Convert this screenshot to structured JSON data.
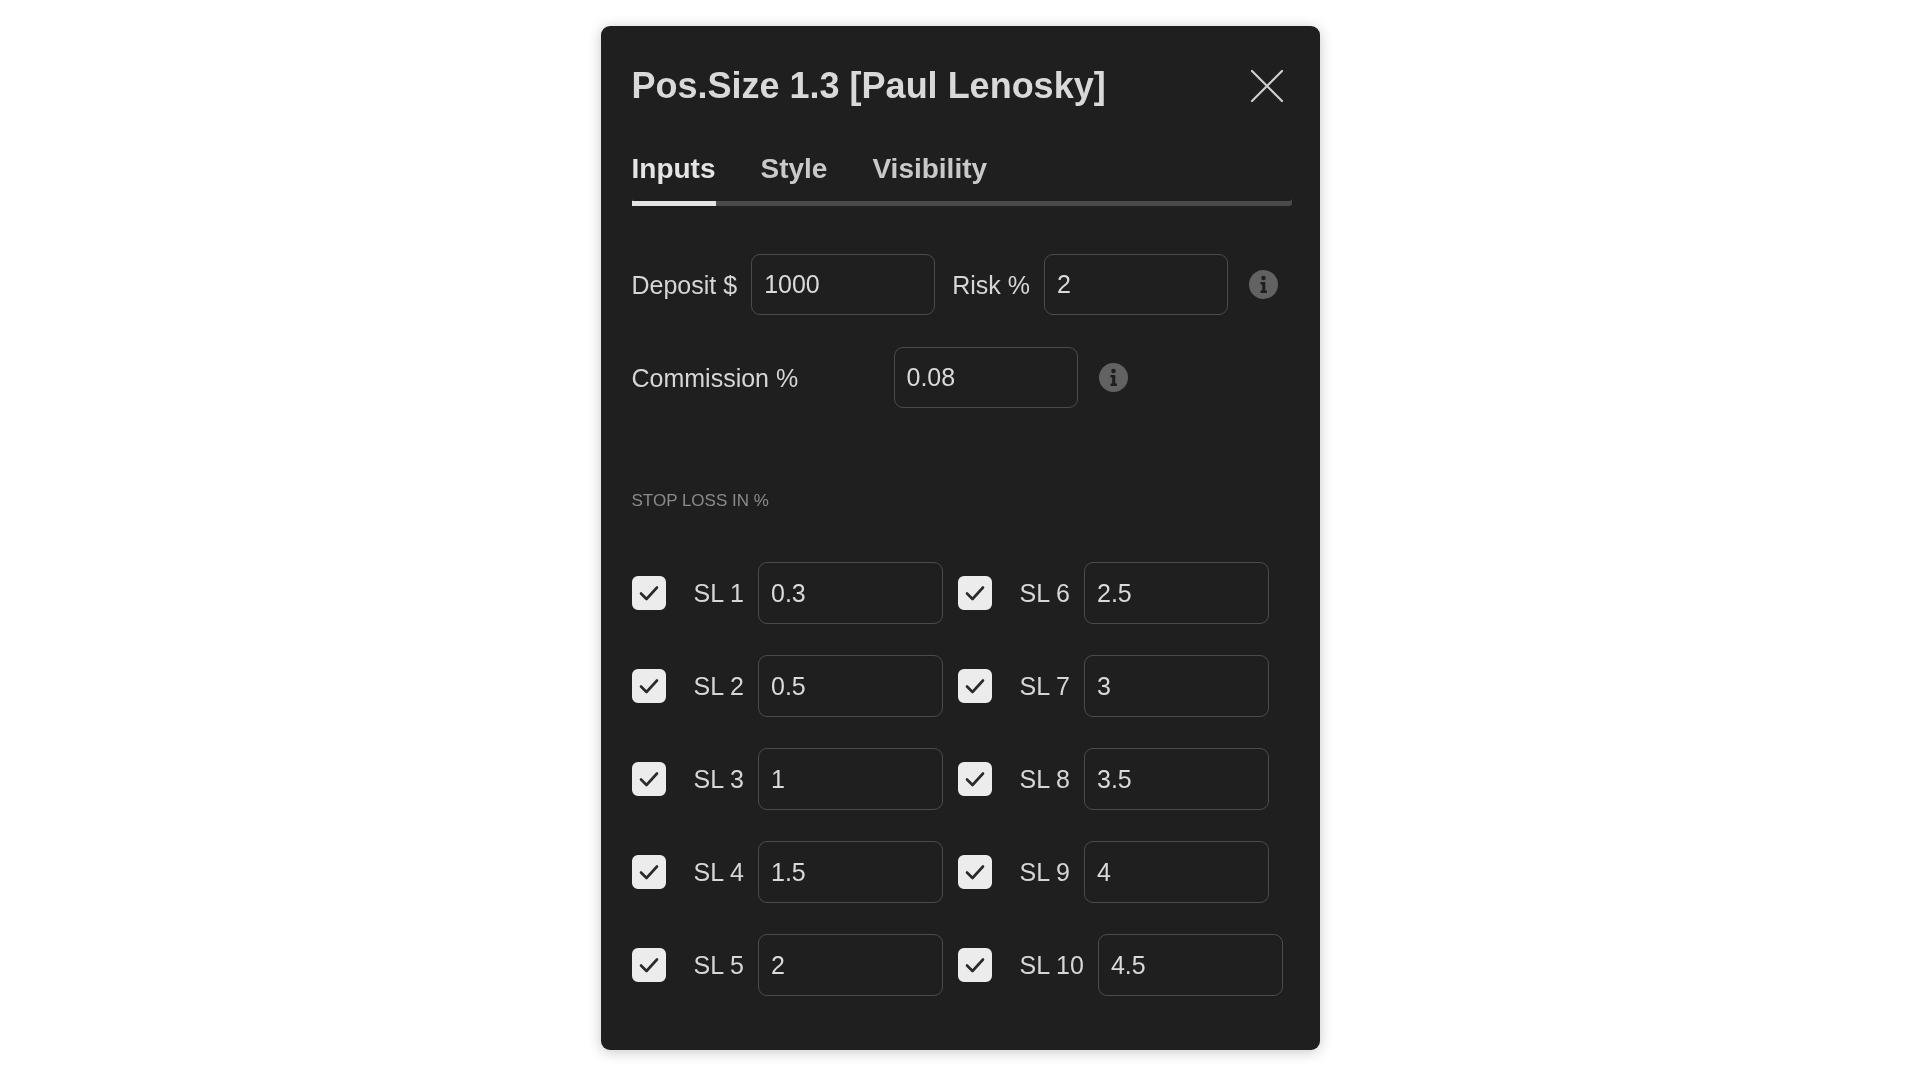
{
  "dialog": {
    "title": "Pos.Size 1.3 [Paul Lenosky]"
  },
  "tabs": [
    {
      "label": "Inputs",
      "selected": true
    },
    {
      "label": "Style",
      "selected": false
    },
    {
      "label": "Visibility",
      "selected": false
    }
  ],
  "input_rows": [
    {
      "fields": [
        {
          "label": "Deposit $",
          "value": "1000"
        },
        {
          "label": "Risk %",
          "value": "2"
        }
      ]
    },
    {
      "fields": [
        {
          "label": "Commission %",
          "value": "0.08"
        }
      ]
    }
  ],
  "section": {
    "title": "STOP LOSS IN %"
  },
  "stop_losses": [
    {
      "label": "SL 1",
      "value": "0.3",
      "checked": true
    },
    {
      "label": "SL 2",
      "value": "0.5",
      "checked": true
    },
    {
      "label": "SL 3",
      "value": "1",
      "checked": true
    },
    {
      "label": "SL 4",
      "value": "1.5",
      "checked": true
    },
    {
      "label": "SL 5",
      "value": "2",
      "checked": true
    },
    {
      "label": "SL 6",
      "value": "2.5",
      "checked": true
    },
    {
      "label": "SL 7",
      "value": "3",
      "checked": true
    },
    {
      "label": "SL 8",
      "value": "3.5",
      "checked": true
    },
    {
      "label": "SL 9",
      "value": "4",
      "checked": true
    },
    {
      "label": "SL 10",
      "value": "4.5",
      "checked": true
    }
  ]
}
